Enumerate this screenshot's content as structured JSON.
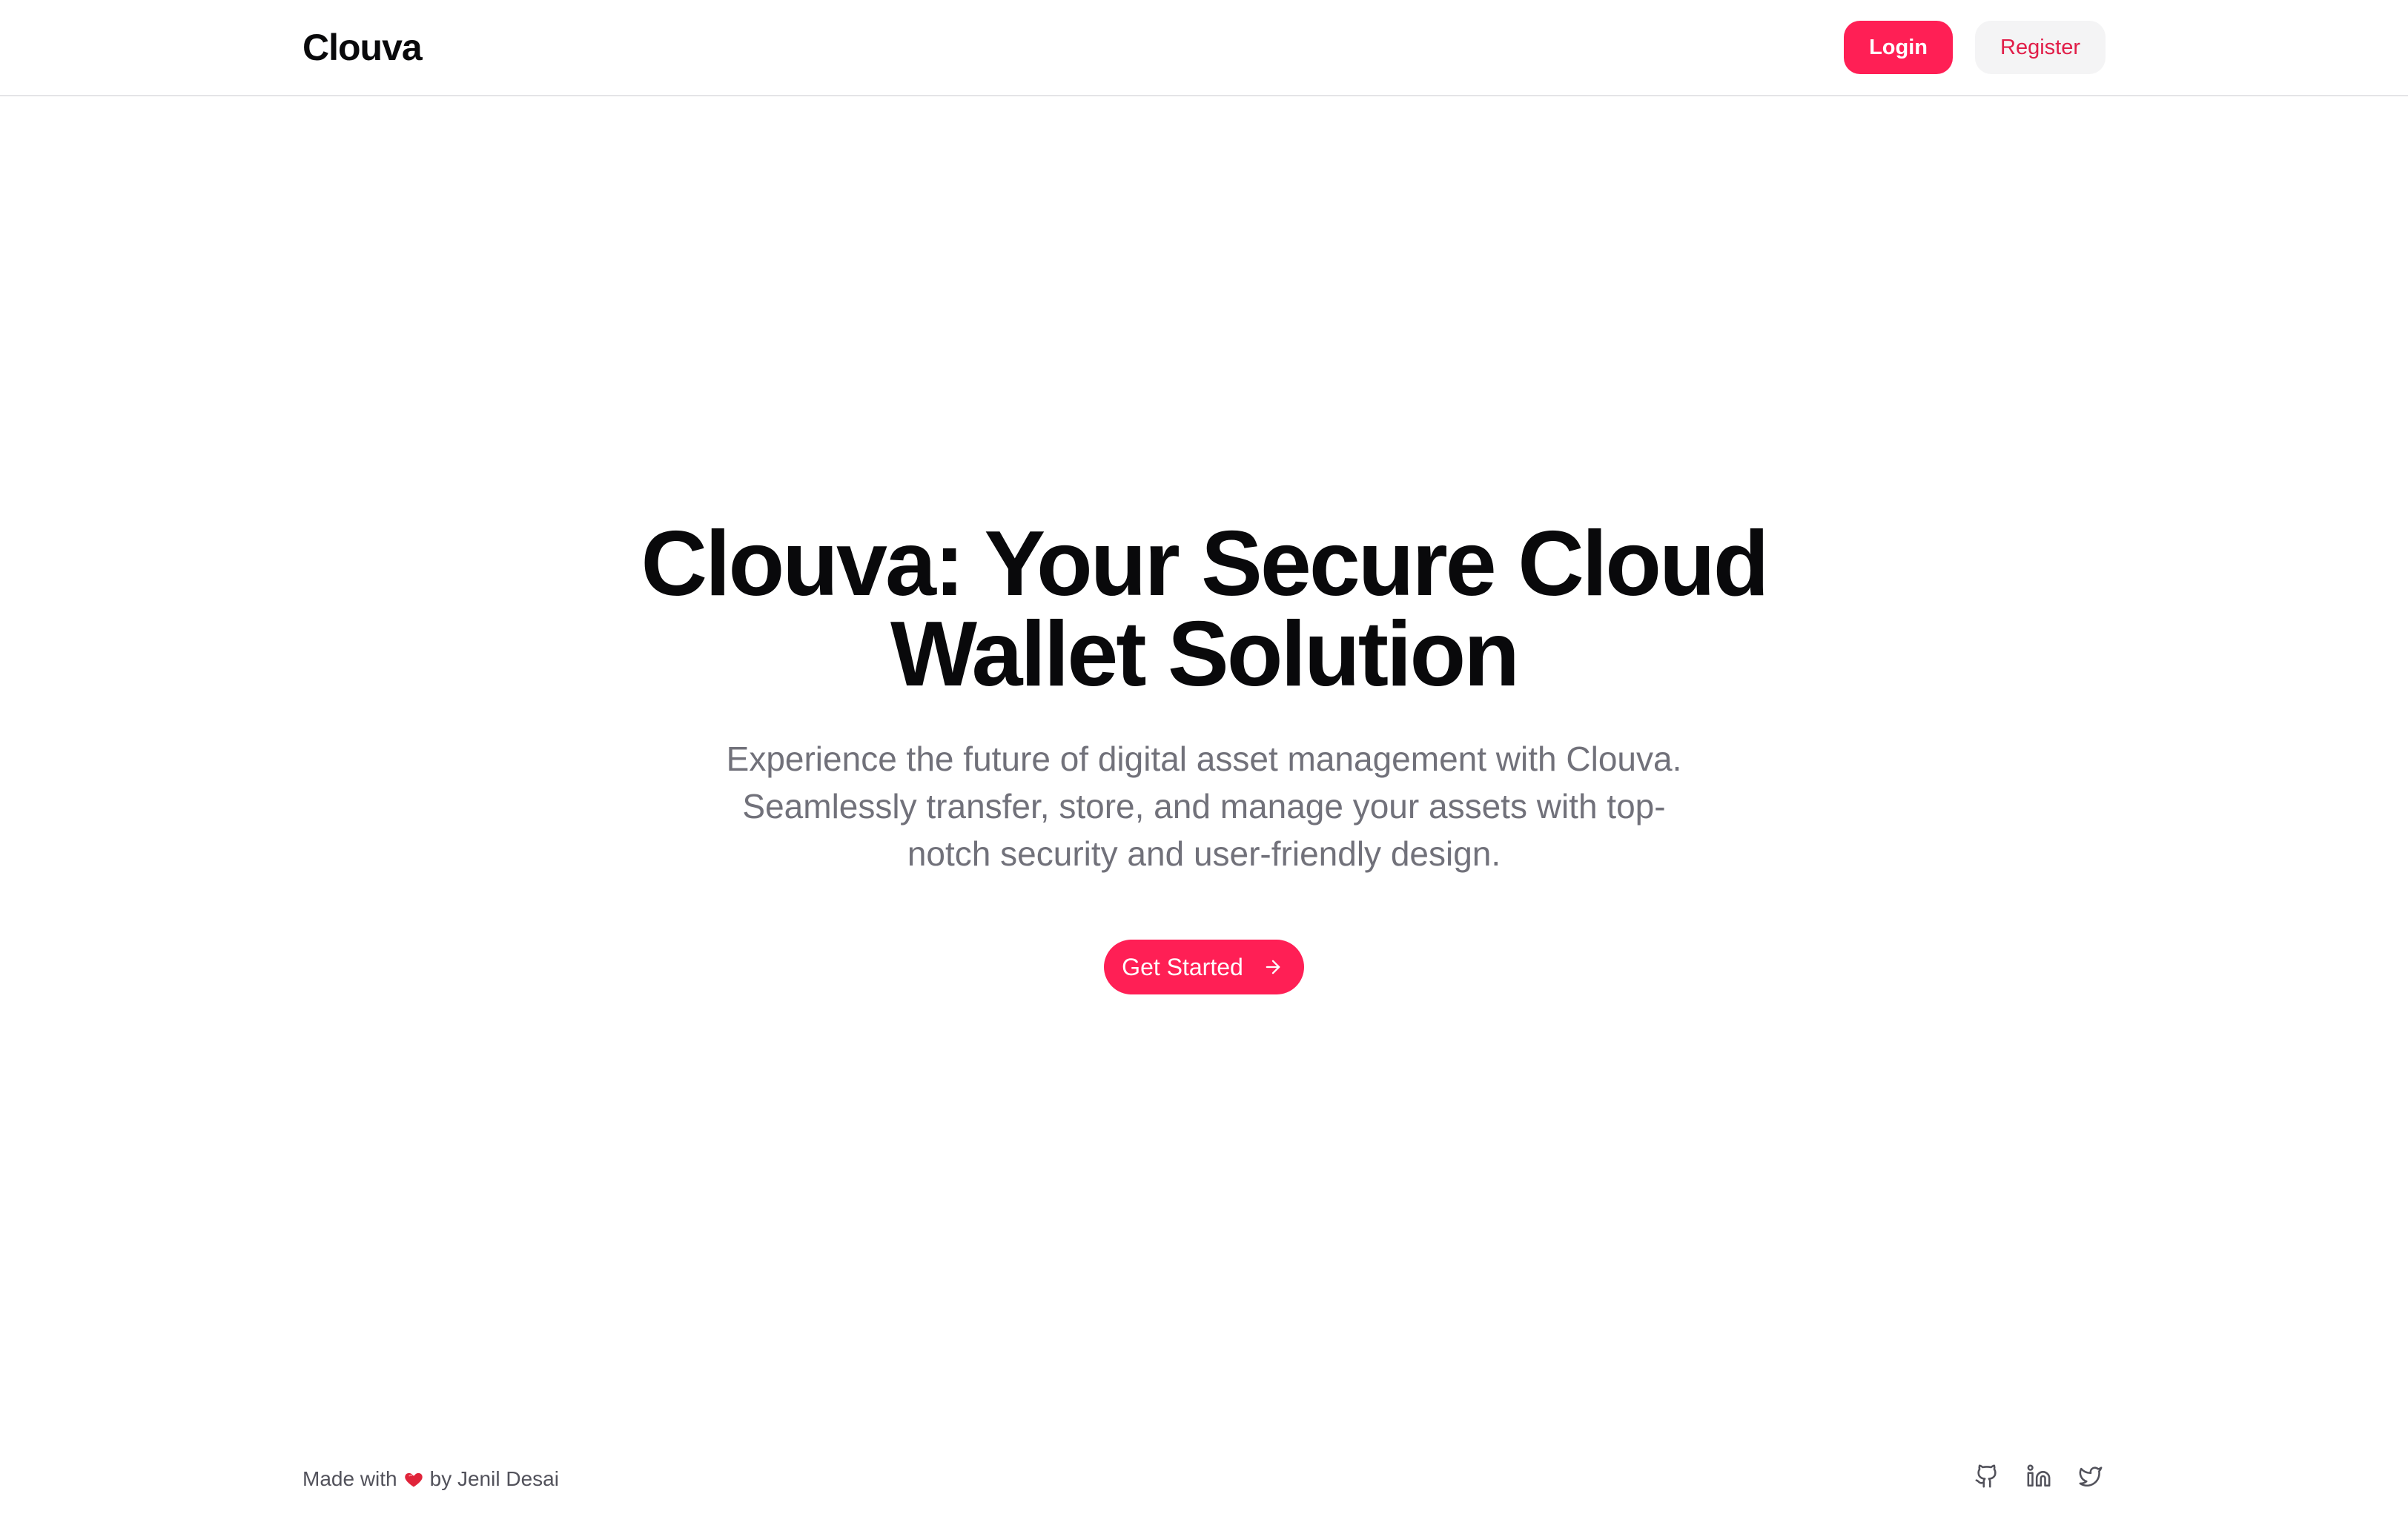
{
  "header": {
    "brand": "Clouva",
    "login_label": "Login",
    "register_label": "Register"
  },
  "hero": {
    "title": "Clouva: Your Secure Cloud Wallet Solution",
    "subtitle": "Experience the future of digital asset management with Clouva. Seamlessly transfer, store, and manage your assets with top-notch security and user-friendly design.",
    "cta_label": "Get Started",
    "cta_icon": "arrow-right-icon"
  },
  "footer": {
    "credit_prefix": "Made with",
    "credit_icon": "heart-icon",
    "credit_suffix": "by Jenil Desai",
    "social_icons": [
      "github-icon",
      "linkedin-icon",
      "twitter-icon"
    ]
  },
  "colors": {
    "accent": "#ff1f55",
    "register_text": "#e11d48",
    "muted_text": "#71717a",
    "heading_text": "#09090b",
    "register_bg": "#f4f4f5",
    "border": "#e4e4e7"
  }
}
